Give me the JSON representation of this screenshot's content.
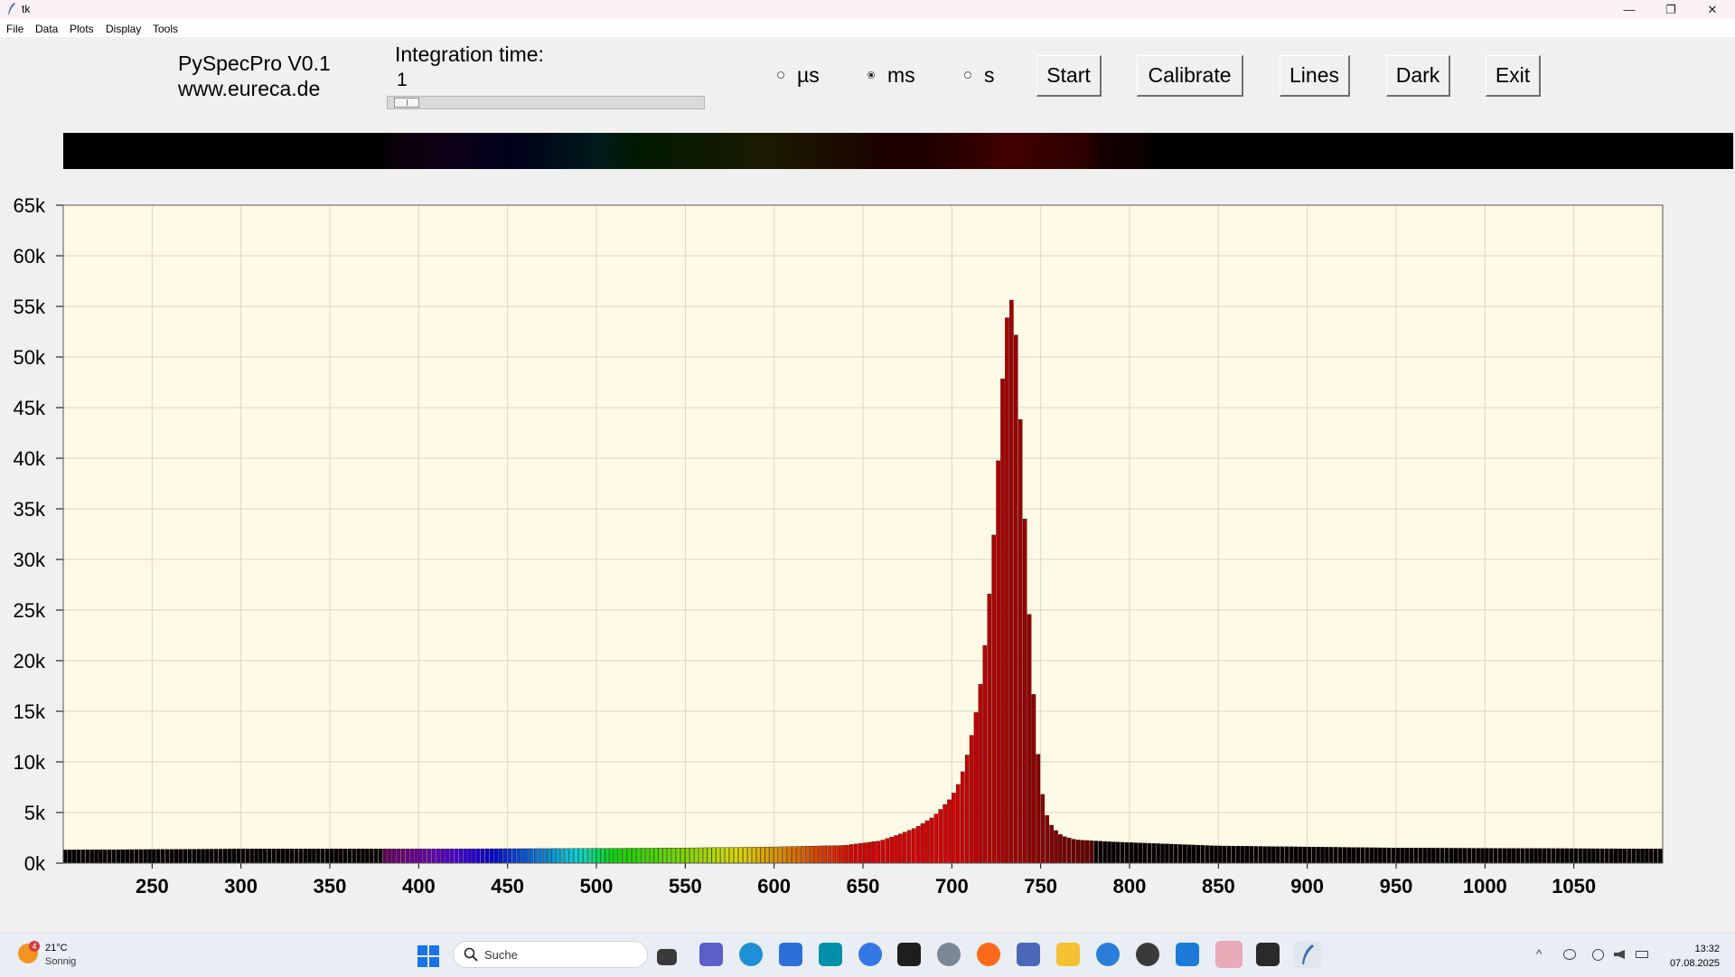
{
  "window": {
    "title": "tk",
    "min_glyph": "—",
    "max_glyph": "❐",
    "close_glyph": "✕"
  },
  "menu": [
    "File",
    "Data",
    "Plots",
    "Display",
    "Tools"
  ],
  "header": {
    "app_name": "PySpecPro V0.1",
    "website": "www.eureca.de"
  },
  "integration": {
    "label": "Integration time:",
    "value": "1",
    "slider_fraction": 0.02
  },
  "units": [
    {
      "label": "µs",
      "selected": false
    },
    {
      "label": "ms",
      "selected": true
    },
    {
      "label": "s",
      "selected": false
    }
  ],
  "buttons": {
    "start": "Start",
    "calibrate": "Calibrate",
    "lines": "Lines",
    "dark": "Dark",
    "exit": "Exit"
  },
  "chart_data": {
    "type": "bar",
    "xlim": [
      200,
      1100
    ],
    "ylim": [
      0,
      65000
    ],
    "grid": true,
    "background": "#fefae5",
    "xticks": [
      250,
      300,
      350,
      400,
      450,
      500,
      550,
      600,
      650,
      700,
      750,
      800,
      850,
      900,
      950,
      1000,
      1050
    ],
    "xtick_labels": [
      "250",
      "300",
      "350",
      "400",
      "450",
      "500",
      "550",
      "600",
      "650",
      "700",
      "750",
      "800",
      "850",
      "900",
      "950",
      "1000",
      "1050"
    ],
    "yticks": [
      0,
      5000,
      10000,
      15000,
      20000,
      25000,
      30000,
      35000,
      40000,
      45000,
      50000,
      55000,
      60000,
      65000
    ],
    "ytick_labels": [
      "0k",
      "5k",
      "10k",
      "15k",
      "20k",
      "25k",
      "30k",
      "35k",
      "40k",
      "45k",
      "50k",
      "55k",
      "60k",
      "65k"
    ],
    "peak": {
      "x": 733,
      "y": 56500
    },
    "profile": [
      [
        200,
        1300
      ],
      [
        300,
        1400
      ],
      [
        400,
        1400
      ],
      [
        500,
        1450
      ],
      [
        550,
        1500
      ],
      [
        600,
        1600
      ],
      [
        640,
        1750
      ],
      [
        660,
        2200
      ],
      [
        670,
        2800
      ],
      [
        680,
        3500
      ],
      [
        690,
        4600
      ],
      [
        700,
        6500
      ],
      [
        705,
        8200
      ],
      [
        710,
        11500
      ],
      [
        715,
        16000
      ],
      [
        718,
        20000
      ],
      [
        721,
        26000
      ],
      [
        724,
        33000
      ],
      [
        727,
        42000
      ],
      [
        730,
        52000
      ],
      [
        733,
        56500
      ],
      [
        736,
        53000
      ],
      [
        739,
        43000
      ],
      [
        742,
        31000
      ],
      [
        745,
        20000
      ],
      [
        748,
        12000
      ],
      [
        751,
        7000
      ],
      [
        754,
        4500
      ],
      [
        757,
        3500
      ],
      [
        762,
        2700
      ],
      [
        770,
        2300
      ],
      [
        790,
        2100
      ],
      [
        850,
        1700
      ],
      [
        950,
        1500
      ],
      [
        1100,
        1400
      ]
    ]
  },
  "taskbar": {
    "weather_badge": "4",
    "temperature": "21°C",
    "condition": "Sonnig",
    "search_placeholder": "Suche",
    "tray_chevron": "^",
    "time": "13:32",
    "date": "07.08.2025"
  },
  "colors": {
    "title_bar": "#fbf1f6",
    "plot_bg": "#fefae5",
    "spectrum_band": "#000000"
  }
}
